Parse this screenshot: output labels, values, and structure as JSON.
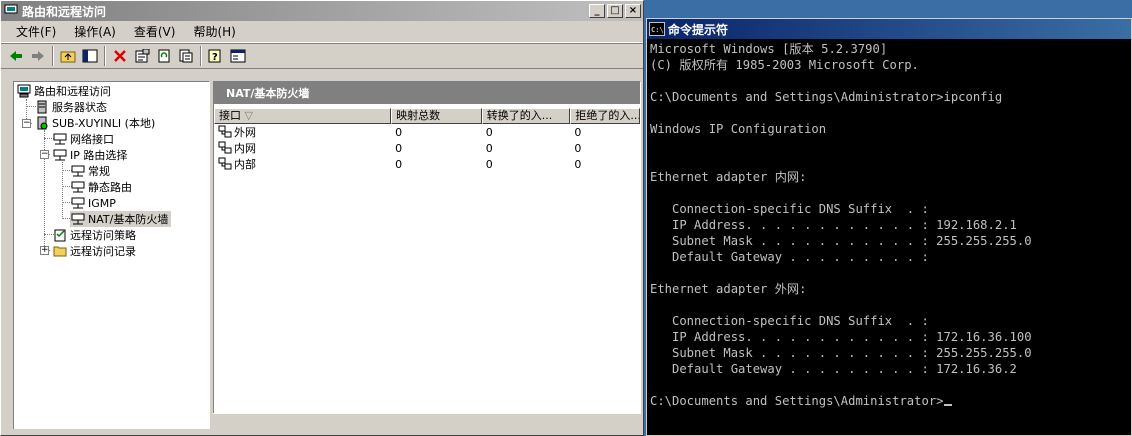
{
  "mmc": {
    "title": "路由和远程访问",
    "menu": [
      "文件(F)",
      "操作(A)",
      "查看(V)",
      "帮助(H)"
    ],
    "tree": {
      "root": "路由和远程访问",
      "server_status": "服务器状态",
      "server": "SUB-XUYINLI (本地)",
      "interfaces": "网络接口",
      "ip_routing": "IP 路由选择",
      "general": "常规",
      "static_routes": "静态路由",
      "igmp": "IGMP",
      "nat": "NAT/基本防火墙",
      "policy": "远程访问策略",
      "logging": "远程访问记录"
    },
    "panel_header": "NAT/基本防火墙",
    "columns": [
      "接口",
      "映射总数",
      "转换了的入...",
      "拒绝了的入..."
    ],
    "rows": [
      {
        "name": "外网",
        "mappings": "0",
        "inbound": "0",
        "rejected": "0"
      },
      {
        "name": "内网",
        "mappings": "0",
        "inbound": "0",
        "rejected": "0"
      },
      {
        "name": "内部",
        "mappings": "0",
        "inbound": "0",
        "rejected": "0"
      }
    ],
    "buttons": {
      "min": "_",
      "max": "□",
      "close": "×"
    }
  },
  "cmd": {
    "title": "命令提示符",
    "lines": [
      "Microsoft Windows [版本 5.2.3790]",
      "(C) 版权所有 1985-2003 Microsoft Corp.",
      "",
      "C:\\Documents and Settings\\Administrator>ipconfig",
      "",
      "Windows IP Configuration",
      "",
      "",
      "Ethernet adapter 内网:",
      "",
      "   Connection-specific DNS Suffix  . :",
      "   IP Address. . . . . . . . . . . . : 192.168.2.1",
      "   Subnet Mask . . . . . . . . . . . : 255.255.255.0",
      "   Default Gateway . . . . . . . . . :",
      "",
      "Ethernet adapter 外网:",
      "",
      "   Connection-specific DNS Suffix  . :",
      "   IP Address. . . . . . . . . . . . : 172.16.36.100",
      "   Subnet Mask . . . . . . . . . . . : 255.255.255.0",
      "   Default Gateway . . . . . . . . . : 172.16.36.2",
      "",
      "C:\\Documents and Settings\\Administrator>"
    ]
  }
}
